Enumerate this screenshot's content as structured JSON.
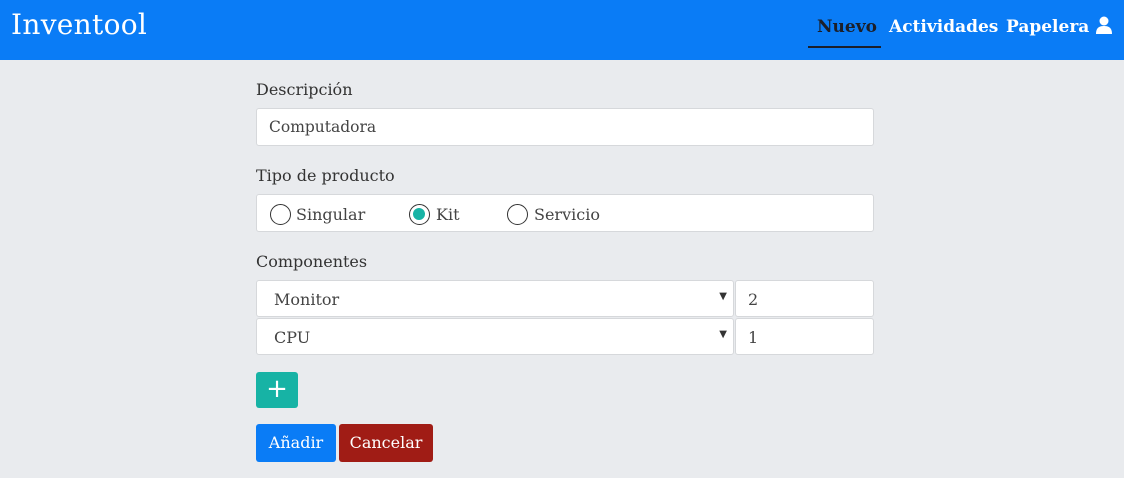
{
  "navbar": {
    "brand": "Inventool",
    "links": [
      {
        "label": "Nuevo",
        "active": true
      },
      {
        "label": "Actividades",
        "active": false
      },
      {
        "label": "Papelera",
        "active": false
      }
    ],
    "user_icon": "user-icon"
  },
  "form": {
    "description": {
      "label": "Descripción",
      "value": "Computadora"
    },
    "product_type": {
      "label": "Tipo de producto",
      "options": [
        {
          "label": "Singular",
          "checked": false
        },
        {
          "label": "Kit",
          "checked": true
        },
        {
          "label": "Servicio",
          "checked": false
        }
      ]
    },
    "components": {
      "label": "Componentes",
      "rows": [
        {
          "item": "Monitor",
          "quantity": "2"
        },
        {
          "item": "CPU",
          "quantity": "1"
        }
      ]
    },
    "add_row_icon": "plus-icon",
    "add_row_symbol": "+",
    "submit_label": "Añadir",
    "cancel_label": "Cancelar"
  },
  "colors": {
    "navbar": "#0a7cf6",
    "teal": "#17b3a5",
    "danger": "#a01c15",
    "background": "#e9ebee"
  }
}
